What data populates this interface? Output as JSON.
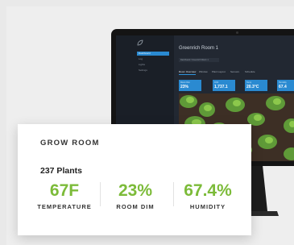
{
  "dashboard": {
    "title": "Greenrich Room 1",
    "breadcrumb": "Dashboard / Greenrich Room 1",
    "nav": [
      "Dashboard",
      "Log",
      "Lights",
      "Settings"
    ],
    "tabs": [
      "Room Overview",
      "Window",
      "Plant Layout",
      "Sensors",
      "Schedule"
    ],
    "tiles": [
      {
        "label": "Room Dim",
        "value": "23%"
      },
      {
        "label": "CO2",
        "value": "1,737.1"
      },
      {
        "label": "Temp",
        "value": "20.3°C"
      },
      {
        "label": "Humidity",
        "value": "67.4"
      }
    ]
  },
  "card": {
    "title": "GROW ROOM",
    "count": "237 Plants",
    "metrics": [
      {
        "value": "67F",
        "label": "TEMPERATURE"
      },
      {
        "value": "23%",
        "label": "ROOM DIM"
      },
      {
        "value": "67.4%",
        "label": "HUMIDITY"
      }
    ]
  },
  "colors": {
    "accent_green": "#7cbb39",
    "accent_blue": "#2a8ad1",
    "screen_bg": "#222832"
  }
}
